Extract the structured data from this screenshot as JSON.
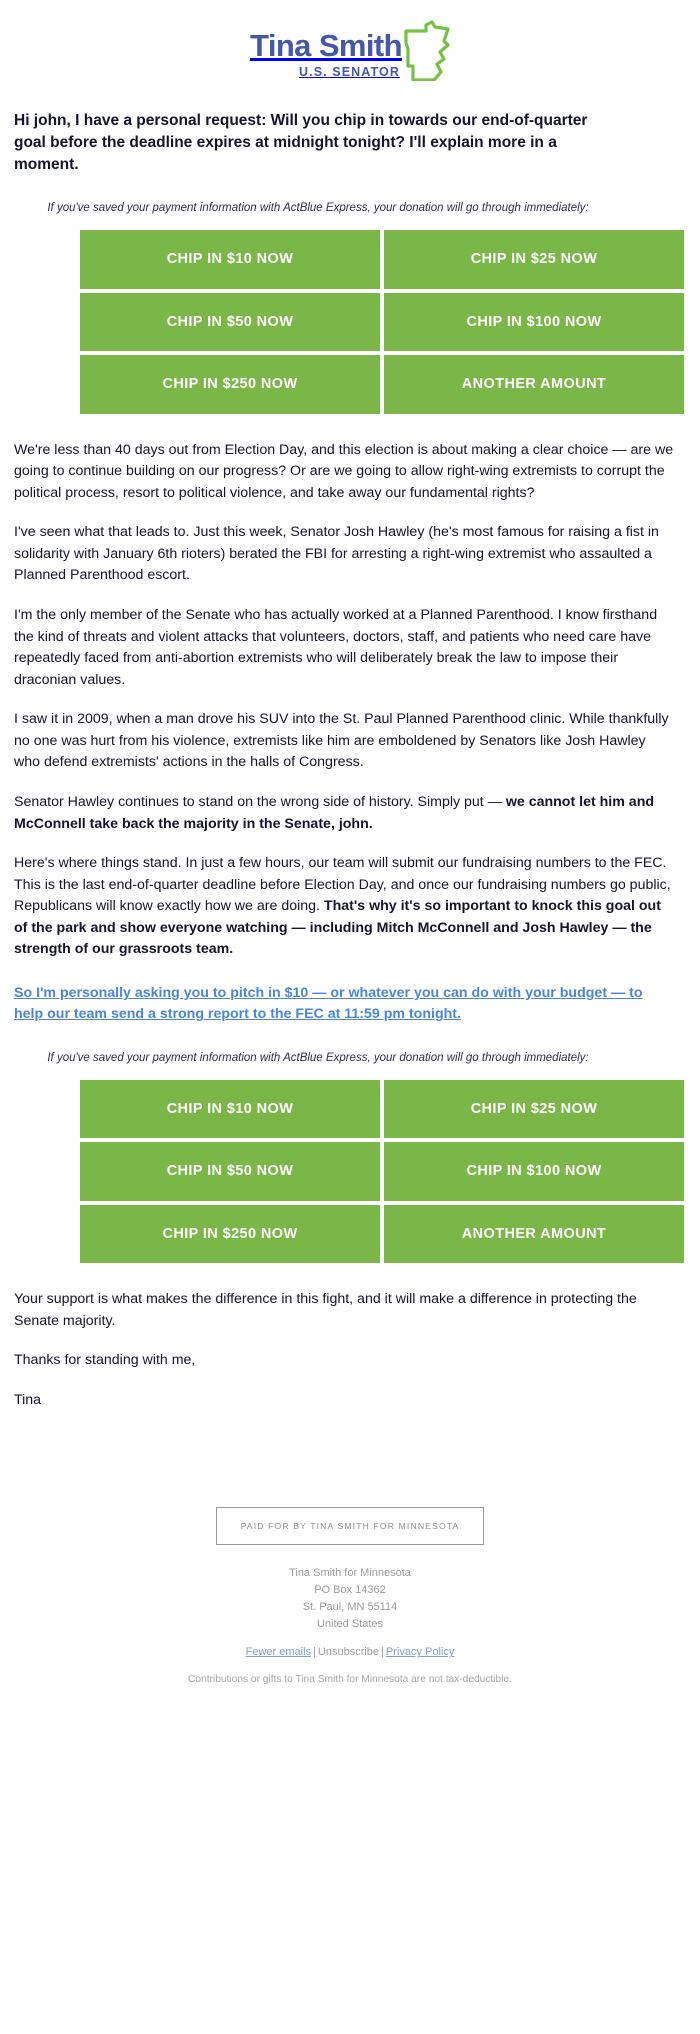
{
  "brand": {
    "name": "Tina Smith",
    "subtitle": "U.S. SENATOR",
    "logo_blue": "#4557a7",
    "accent_green": "#7ab648",
    "link_blue": "#4a86d8",
    "state_icon": "minnesota-outline-icon"
  },
  "headline": "Hi john, I have a personal request: Will you chip in towards our end-of-quarter goal before the deadline expires at midnight tonight? I'll explain more in a moment.",
  "actblue_note": "If you've saved your payment information with ActBlue Express, your donation will go through immediately:",
  "asks": [
    {
      "label": "CHIP IN $10 NOW",
      "amount": "10"
    },
    {
      "label": "CHIP IN $25 NOW",
      "amount": "25"
    },
    {
      "label": "CHIP IN $50 NOW",
      "amount": "50"
    },
    {
      "label": "CHIP IN $100 NOW",
      "amount": "100"
    },
    {
      "label": "CHIP IN $250 NOW",
      "amount": "250"
    },
    {
      "label": "ANOTHER AMOUNT",
      "amount": "other"
    }
  ],
  "body": {
    "p1": "We're less than 40 days out from Election Day, and this election is about making a clear choice — are we going to continue building on our progress? Or are we going to allow right-wing extremists to corrupt the political process, resort to political violence, and take away our fundamental rights?",
    "p2": "I've seen what that leads to. Just this week, Senator Josh Hawley (he's most famous for raising a fist in solidarity with January 6th rioters) berated the FBI for arresting a right-wing extremist who assaulted a Planned Parenthood escort.",
    "p3": "I'm the only member of the Senate who has actually worked at a Planned Parenthood. I know firsthand the kind of threats and violent attacks that volunteers, doctors, staff, and patients who need care have repeatedly faced from anti-abortion extremists who will deliberately break the law to impose their draconian values.",
    "p4": "I saw it in 2009, when a man drove his SUV into the St. Paul Planned Parenthood clinic. While thankfully no one was hurt from his violence, extremists like him are emboldened by Senators like Josh Hawley who defend extremists' actions in the halls of Congress.",
    "p5_lead": "Senator Hawley continues to stand on the wrong side of history. Simply put — ",
    "p5_bold": "we cannot let him and McConnell take back the majority in the Senate, john.",
    "p6_lead": "Here's where things stand. In just a few hours, our team will submit our fundraising numbers to the FEC. This is the last end-of-quarter deadline before Election Day, and once our fundraising numbers go public, Republicans will know exactly how we are doing. ",
    "p6_bold": "That's why it's so important to knock this goal out of the park and show everyone watching — including Mitch McConnell and Josh Hawley — the strength of our grassroots team.",
    "link_para": "So I'm personally asking you to pitch in $10 — or whatever you can do with your budget — to help our team send a strong report to the FEC at 11:59 pm tonight.",
    "p7": "Your support is what makes the difference in this fight, and it will make a difference in protecting the Senate majority.",
    "p8": "Thanks for standing with me,",
    "p9": "Tina"
  },
  "footer": {
    "paid_for": "PAID FOR BY TINA SMITH FOR MINNESOTA",
    "address": [
      "Tina Smith for Minnesota",
      "PO Box 14362",
      "St. Paul, MN 55114",
      "United States"
    ],
    "links": {
      "fewer_emails": "Fewer emails",
      "unsubscribe": "Unsubscribe",
      "privacy_policy": "Privacy Policy",
      "separator": "|"
    },
    "disclaimer": "Contributions or gifts to Tina Smith for Minnesota are not tax-deductible."
  }
}
